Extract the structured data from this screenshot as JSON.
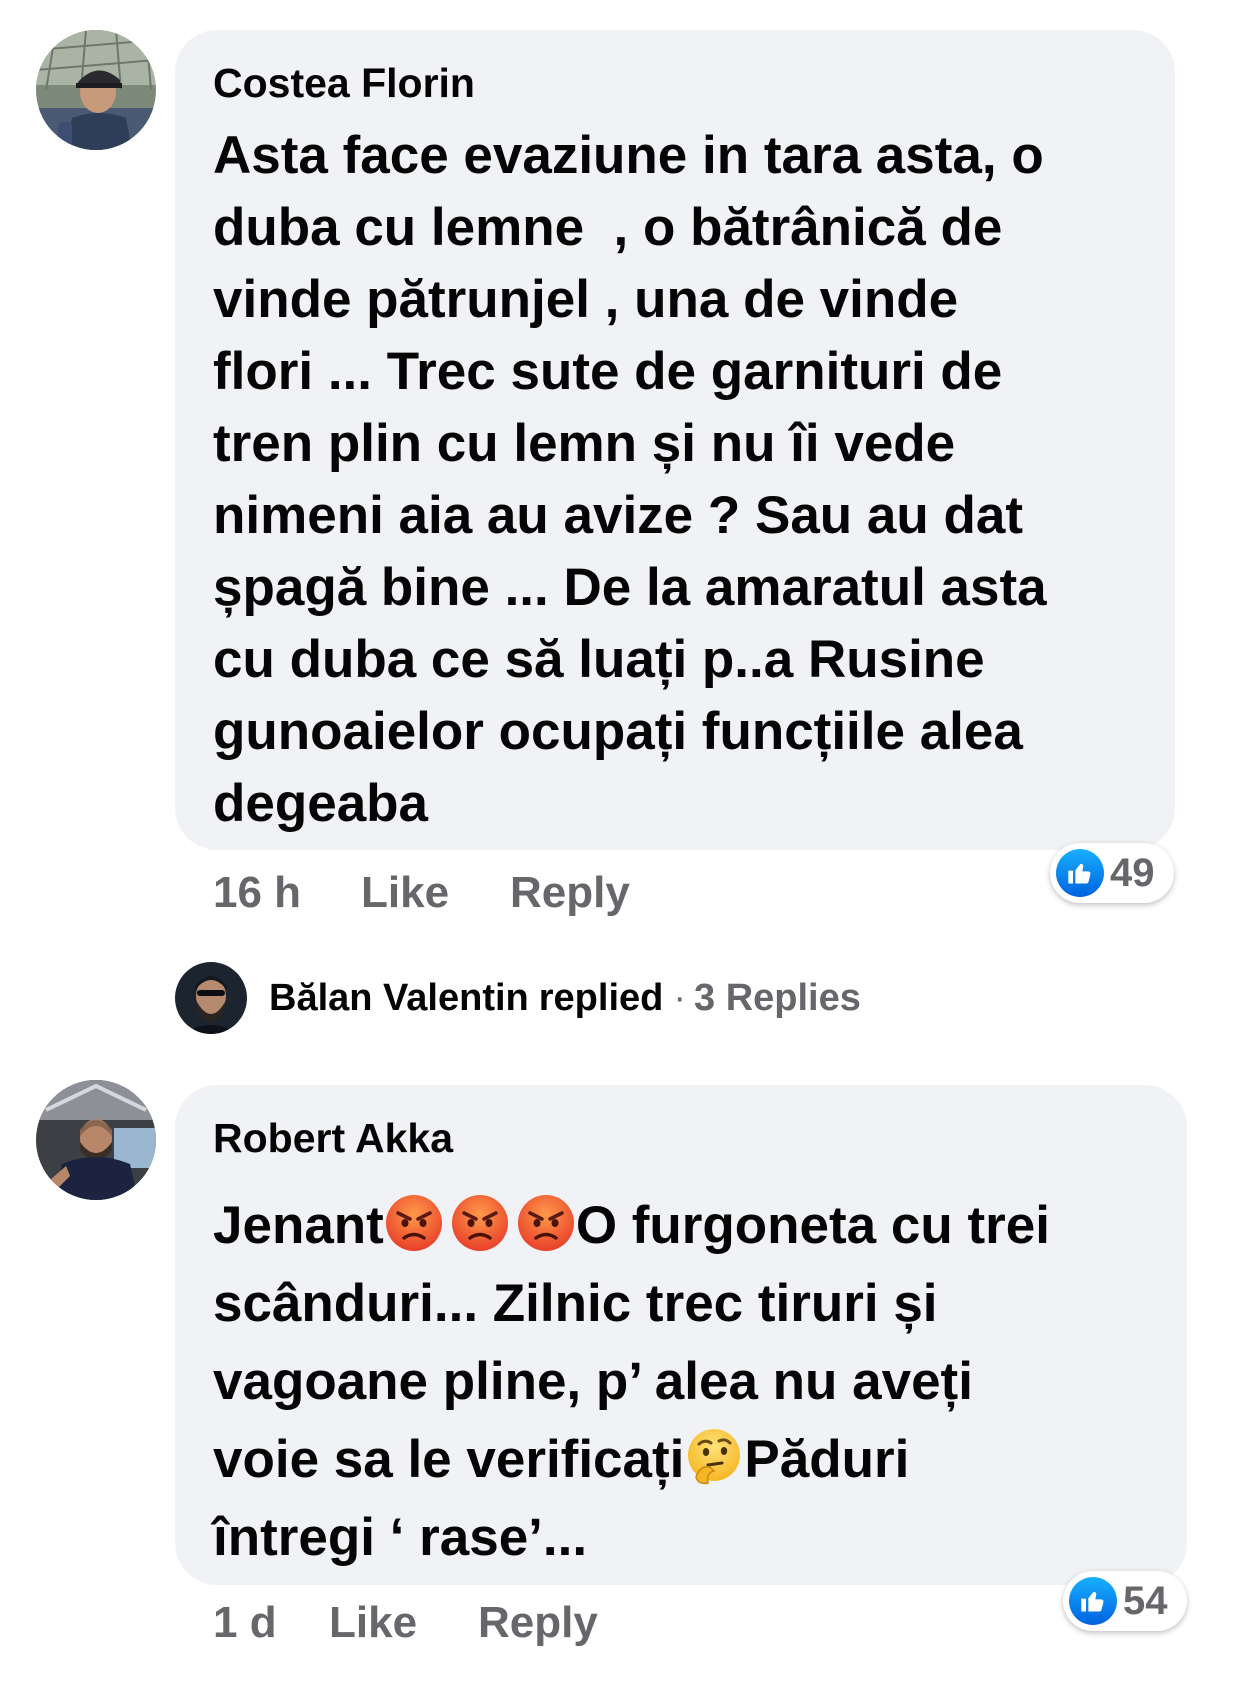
{
  "comments": [
    {
      "author": "Costea Florin",
      "avatar_icon": "profile-photo-man-cap",
      "lines": [
        "Asta face evaziune in tara asta, o",
        "duba cu lemne  , o bătrânică de",
        "vinde pătrunjel , una de vinde",
        "flori ... Trec sute de garnituri de",
        "tren plin cu lemn și nu îi vede",
        "nimeni aia au avize ? Sau au dat",
        "șpagă bine ... De la amaratul asta",
        "cu duba ce să luați p..a Rusine",
        "gunoaielor ocupați funcțiile alea",
        "degeaba"
      ],
      "time": "16 h",
      "like_label": "Like",
      "reply_label": "Reply",
      "reaction_icon": "like-icon",
      "reaction_count": "49"
    },
    {
      "author": "Robert Akka",
      "avatar_icon": "profile-photo-man-car",
      "line1_pre": "Jenant",
      "line1_post": "O furgoneta cu trei",
      "line1_emojis": [
        "angry-face-icon",
        "angry-face-icon",
        "angry-face-icon"
      ],
      "line2": "scânduri... Zilnic trec tiruri și",
      "line3": "vagoane pline, p’ alea nu aveți",
      "line4_pre": "voie sa le verificați",
      "line4_emoji": "thinking-face-icon",
      "line4_post": "Păduri",
      "line5": "întregi ‘ rase’...",
      "time": "1 d",
      "like_label": "Like",
      "reply_label": "Reply",
      "reaction_icon": "like-icon",
      "reaction_count": "54"
    }
  ],
  "replies_summary": {
    "replier": "Bălan Valentin",
    "replied_word": "replied",
    "separator": "·",
    "count_label": "3 Replies"
  },
  "colors": {
    "bubble": "#f0f2f5",
    "secondary_text": "#65676b",
    "like_blue": "#1877f2"
  }
}
